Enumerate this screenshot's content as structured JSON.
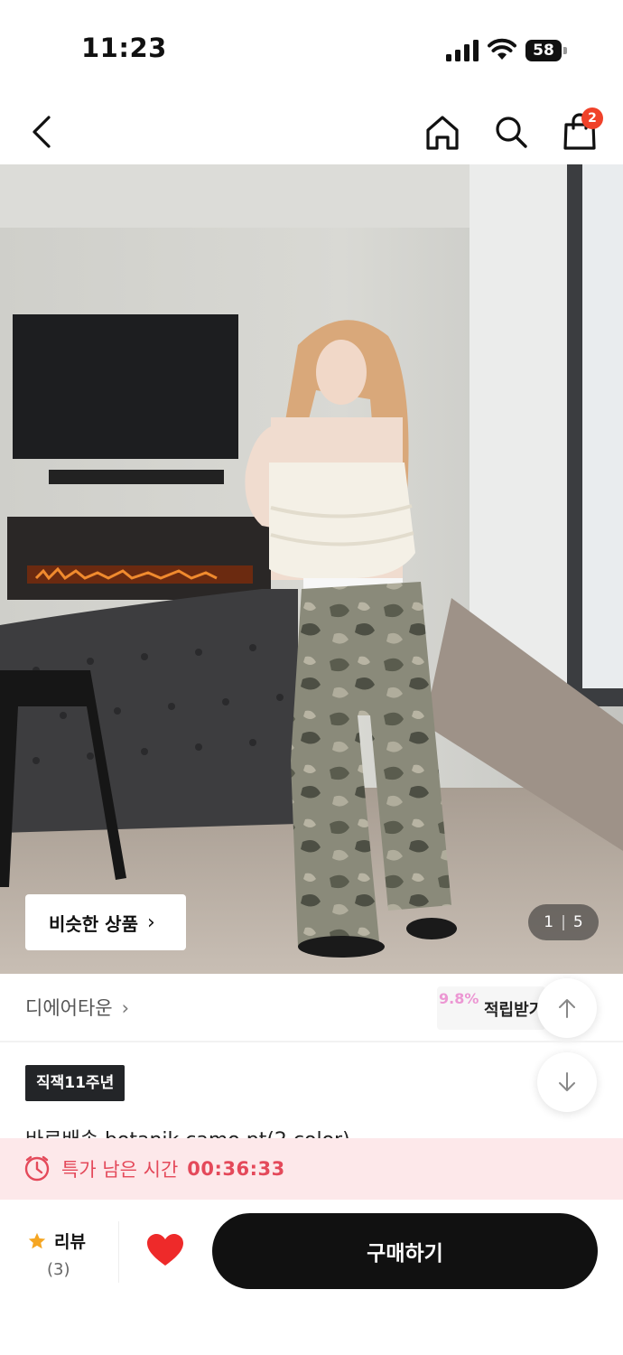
{
  "status_bar": {
    "time": "11:23",
    "battery": "58"
  },
  "header": {
    "cart_count": "2"
  },
  "gallery": {
    "similar_label": "비슷한 상품",
    "page_current": "1",
    "page_total": "5"
  },
  "brand": {
    "name": "디에어타운"
  },
  "points": {
    "rate": "9.8%",
    "label": "적립받기"
  },
  "product": {
    "tag": "직잭11주년",
    "title": "바로배송 botanik camo pt(2 color)"
  },
  "timer": {
    "label": "특가 남은 시간",
    "value": "00:36:33"
  },
  "bottom_bar": {
    "review_label": "리뷰",
    "review_count": "(3)",
    "buy_label": "구매하기"
  },
  "colors": {
    "accent_red": "#f0422a",
    "timer_text": "#e4495a",
    "timer_bg": "#fde8ea",
    "buy_bg": "#111111"
  }
}
